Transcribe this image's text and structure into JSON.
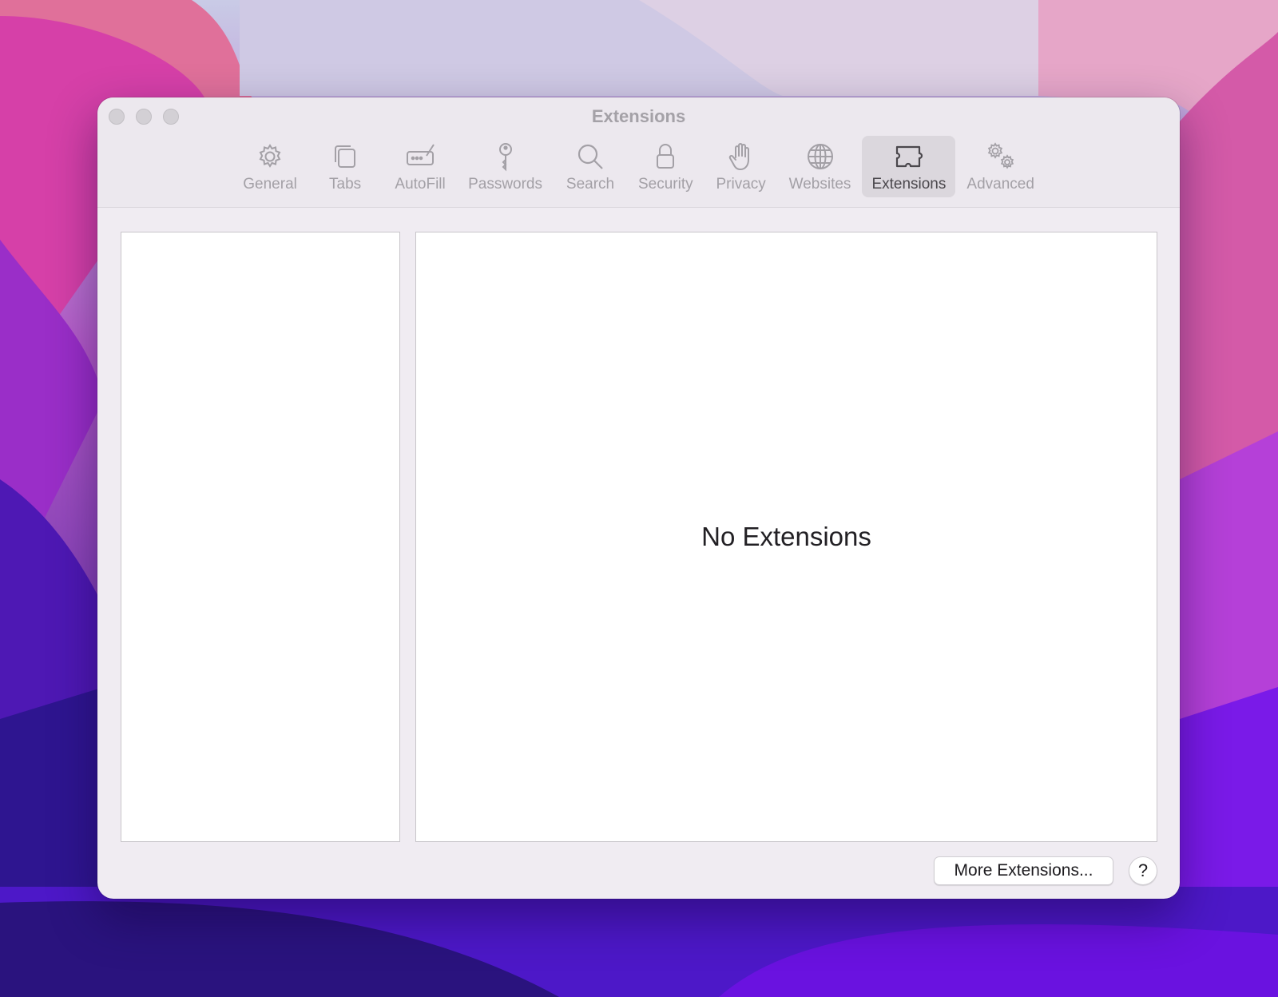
{
  "window": {
    "title": "Extensions"
  },
  "toolbar": {
    "items": [
      {
        "label": "General",
        "icon": "gear-icon"
      },
      {
        "label": "Tabs",
        "icon": "tabs-icon"
      },
      {
        "label": "AutoFill",
        "icon": "autofill-icon"
      },
      {
        "label": "Passwords",
        "icon": "key-icon"
      },
      {
        "label": "Search",
        "icon": "magnifier-icon"
      },
      {
        "label": "Security",
        "icon": "lock-icon"
      },
      {
        "label": "Privacy",
        "icon": "hand-icon"
      },
      {
        "label": "Websites",
        "icon": "globe-icon"
      },
      {
        "label": "Extensions",
        "icon": "puzzle-icon",
        "selected": true
      },
      {
        "label": "Advanced",
        "icon": "gears-icon"
      }
    ]
  },
  "content": {
    "empty_message": "No Extensions"
  },
  "footer": {
    "more_label": "More Extensions...",
    "help_label": "?"
  },
  "colors": {
    "window_bg": "#f0ecf2",
    "selected_tab_bg": "#dbd7dd",
    "inactive_icon": "#a3a0a6"
  }
}
